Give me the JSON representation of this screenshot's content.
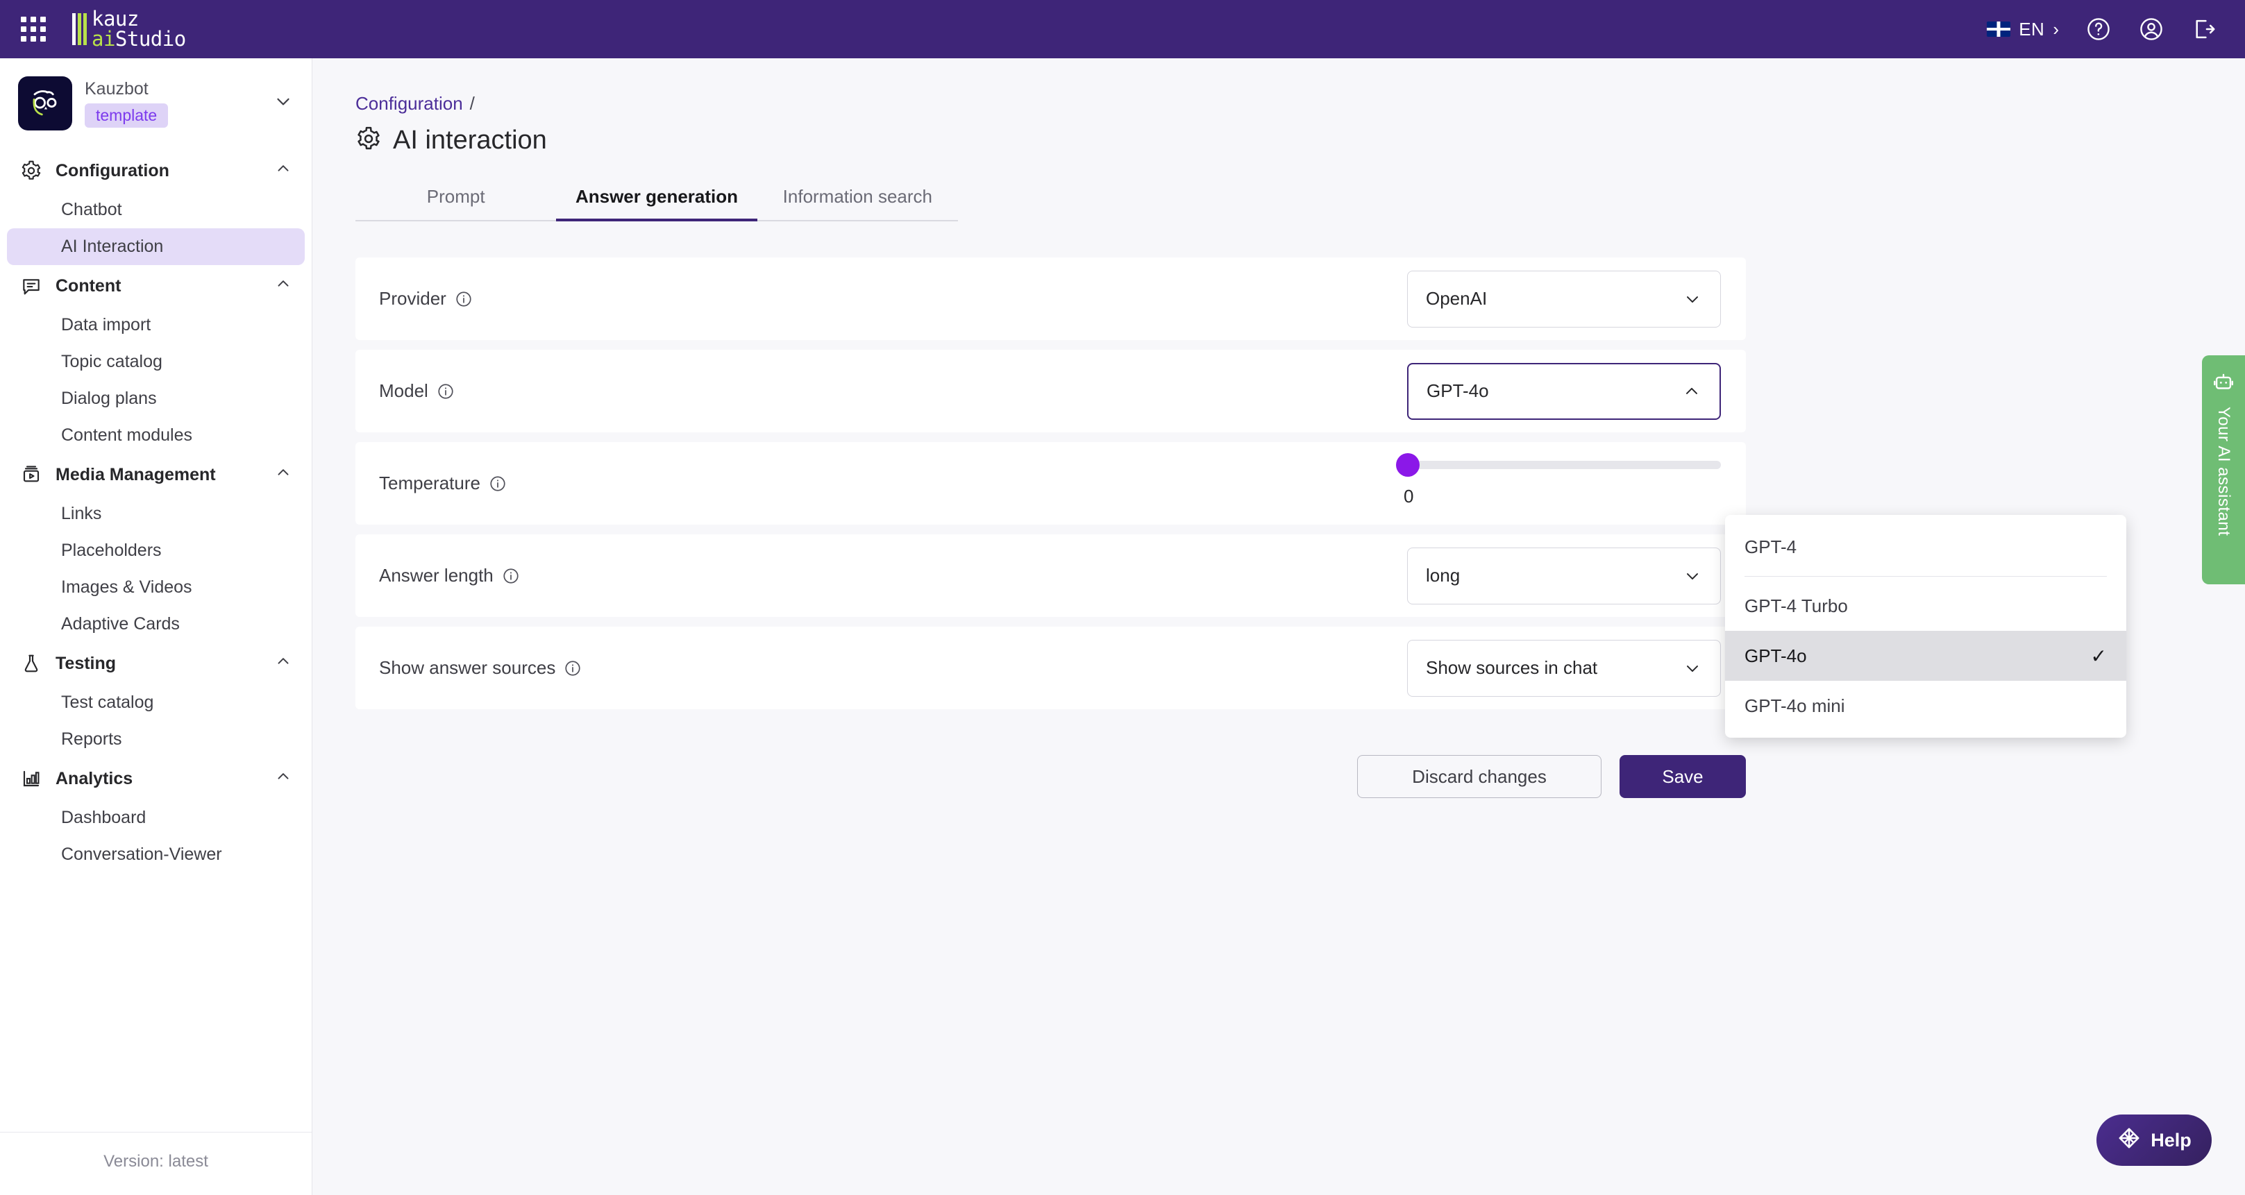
{
  "topbar": {
    "apps_icon": "grid-apps-icon",
    "logo_line1": "kauz",
    "logo_line2_a": "ai",
    "logo_line2_b": "Studio",
    "language": "EN",
    "language_chevron": "›",
    "help_icon": "help-circle-icon",
    "account_icon": "account-circle-icon",
    "logout_icon": "logout-icon",
    "background": "#3E2578"
  },
  "sidebar": {
    "bot_name": "Kauzbot",
    "bot_badge": "template",
    "bot_caret": "⌄",
    "groups": [
      {
        "label": "Configuration",
        "icon": "gear-icon",
        "items": [
          {
            "label": "Chatbot",
            "active": false
          },
          {
            "label": "AI Interaction",
            "active": true
          }
        ]
      },
      {
        "label": "Content",
        "icon": "chat-bubble-icon",
        "items": [
          {
            "label": "Data import",
            "active": false
          },
          {
            "label": "Topic catalog",
            "active": false
          },
          {
            "label": "Dialog plans",
            "active": false
          },
          {
            "label": "Content modules",
            "active": false
          }
        ]
      },
      {
        "label": "Media Management",
        "icon": "media-icon",
        "items": [
          {
            "label": "Links",
            "active": false
          },
          {
            "label": "Placeholders",
            "active": false
          },
          {
            "label": "Images & Videos",
            "active": false
          },
          {
            "label": "Adaptive Cards",
            "active": false
          }
        ]
      },
      {
        "label": "Testing",
        "icon": "flask-icon",
        "items": [
          {
            "label": "Test catalog",
            "active": false
          },
          {
            "label": "Reports",
            "active": false
          }
        ]
      },
      {
        "label": "Analytics",
        "icon": "bar-chart-icon",
        "items": [
          {
            "label": "Dashboard",
            "active": false
          },
          {
            "label": "Conversation-Viewer",
            "active": false
          }
        ]
      }
    ],
    "version": "Version: latest"
  },
  "main": {
    "breadcrumb_parent": "Configuration",
    "breadcrumb_separator": "/",
    "page_title": "AI interaction",
    "page_title_icon": "gear-icon",
    "tabs": [
      {
        "label": "Prompt",
        "active": false
      },
      {
        "label": "Answer generation",
        "active": true
      },
      {
        "label": "Information search",
        "active": false
      }
    ],
    "rows": [
      {
        "label": "Provider",
        "info_icon": "info-icon",
        "control": "select",
        "value": "OpenAI",
        "focused": false
      },
      {
        "label": "Model",
        "info_icon": "info-icon",
        "control": "select",
        "value": "GPT-4o",
        "focused": true
      },
      {
        "label": "Temperature",
        "info_icon": "info-icon",
        "control": "slider",
        "value": "0",
        "percent": 0
      },
      {
        "label": "Answer length",
        "info_icon": "info-icon",
        "control": "select",
        "value": "long",
        "focused": false
      },
      {
        "label": "Show answer sources",
        "info_icon": "info-icon",
        "control": "select",
        "value": "Show sources in chat",
        "focused": false
      }
    ],
    "discard_label": "Discard changes",
    "save_label": "Save"
  },
  "model_menu": {
    "open": true,
    "options": [
      {
        "label": "GPT-4",
        "selected": false
      },
      {
        "label": "GPT-4 Turbo",
        "selected": false
      },
      {
        "label": "GPT-4o",
        "selected": true
      },
      {
        "label": "GPT-4o mini",
        "selected": false
      }
    ],
    "check_glyph": "✓"
  },
  "assistant": {
    "label": "Your AI assistant",
    "icon": "robot-icon",
    "color": "#6FBD74"
  },
  "help": {
    "label": "Help",
    "icon": "globe-network-icon"
  },
  "colors": {
    "brand_purple": "#3E2578",
    "accent_purple": "#8B18E8",
    "active_nav": "#E4DCF8",
    "page_bg": "#F7F7FA"
  }
}
